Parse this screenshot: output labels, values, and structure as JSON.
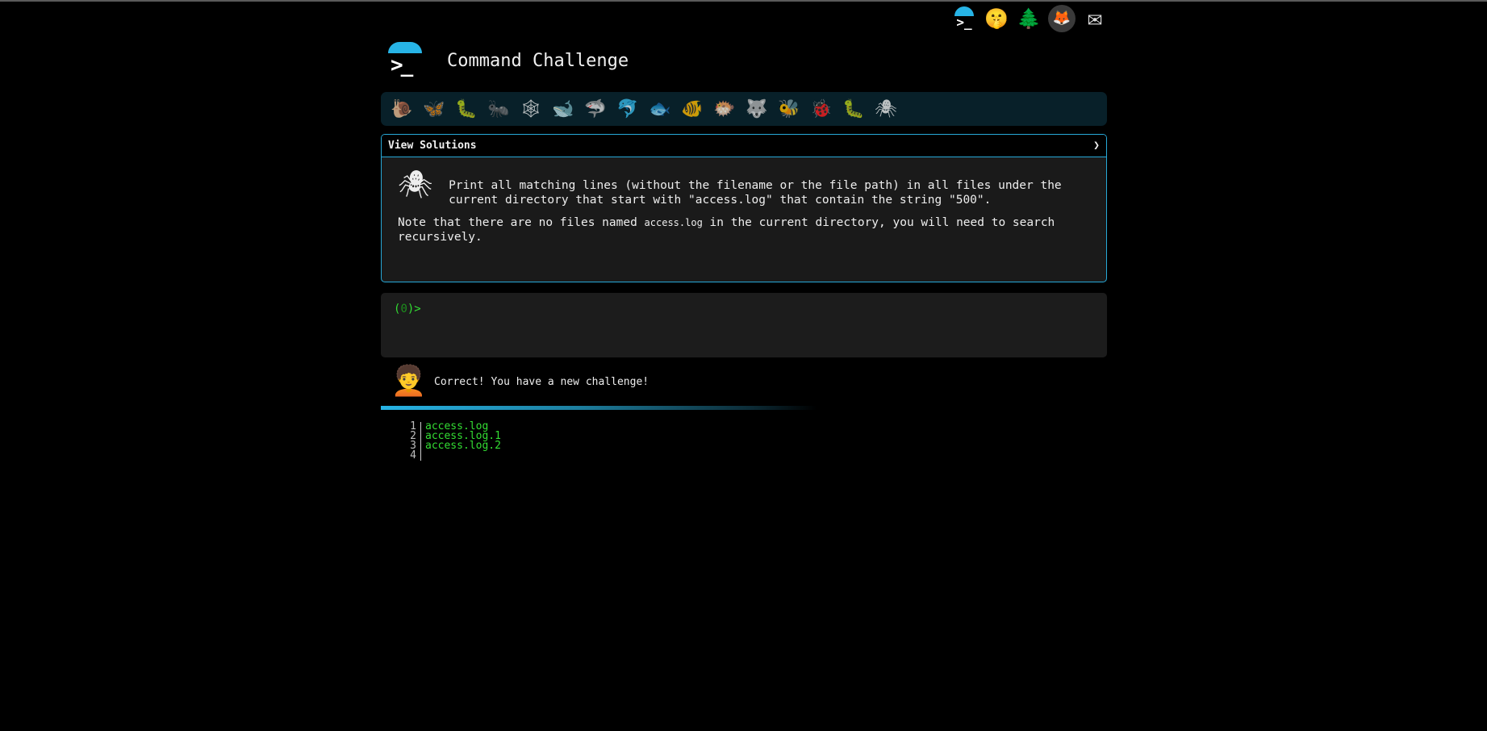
{
  "app": {
    "title": "Command Challenge"
  },
  "top_icons": [
    {
      "name": "terminal-logo-icon",
      "glyph": ">_"
    },
    {
      "name": "shushing-face-icon",
      "glyph": "🤫"
    },
    {
      "name": "tree-icon",
      "glyph": "🌲"
    },
    {
      "name": "gitlab-icon",
      "glyph": "🦊"
    },
    {
      "name": "mail-icon",
      "glyph": "✉"
    }
  ],
  "animals": [
    {
      "name": "snail-icon",
      "glyph": "🐌"
    },
    {
      "name": "butterfly-icon",
      "glyph": "🦋"
    },
    {
      "name": "caterpillar-icon",
      "glyph": "🐛"
    },
    {
      "name": "ant-icon",
      "glyph": "🐜"
    },
    {
      "name": "web-icon",
      "glyph": "🕸"
    },
    {
      "name": "whale-icon",
      "glyph": "🐋"
    },
    {
      "name": "shark-icon",
      "glyph": "🦈"
    },
    {
      "name": "dolphin-icon",
      "glyph": "🐬"
    },
    {
      "name": "fish-icon",
      "glyph": "🐟"
    },
    {
      "name": "tropical-fish-icon",
      "glyph": "🐠"
    },
    {
      "name": "blowfish-icon",
      "glyph": "🐡"
    },
    {
      "name": "wolf-icon",
      "glyph": "🐺"
    },
    {
      "name": "bee-icon",
      "glyph": "🐝"
    },
    {
      "name": "ladybug-icon",
      "glyph": "🐞"
    },
    {
      "name": "worm-icon",
      "glyph": "🐛"
    },
    {
      "name": "bug-icon",
      "glyph": "🕷"
    }
  ],
  "challenge": {
    "header": "View Solutions",
    "chevron": "❯",
    "icon": "🕷",
    "task": "Print all matching lines (without the filename or the file path) in all files under the current directory that start with \"access.log\" that contain the string \"500\".",
    "note_before": "Note that there are no files named ",
    "note_code": "access.log",
    "note_after": " in the current directory, you will need to search recursively."
  },
  "terminal": {
    "prompt_open": "(",
    "prompt_count": "0",
    "prompt_close": ")>",
    "value": ""
  },
  "feedback": {
    "avatar": "🧑‍🦱",
    "message": "Correct! You have a new challenge!"
  },
  "output": [
    {
      "line": "1",
      "text": "access.log"
    },
    {
      "line": "2",
      "text": "access.log.1"
    },
    {
      "line": "3",
      "text": "access.log.2"
    },
    {
      "line": "4",
      "text": ""
    }
  ],
  "colors": {
    "accent": "#27b4e6",
    "terminal_green": "#33dd33",
    "background": "#000000"
  }
}
